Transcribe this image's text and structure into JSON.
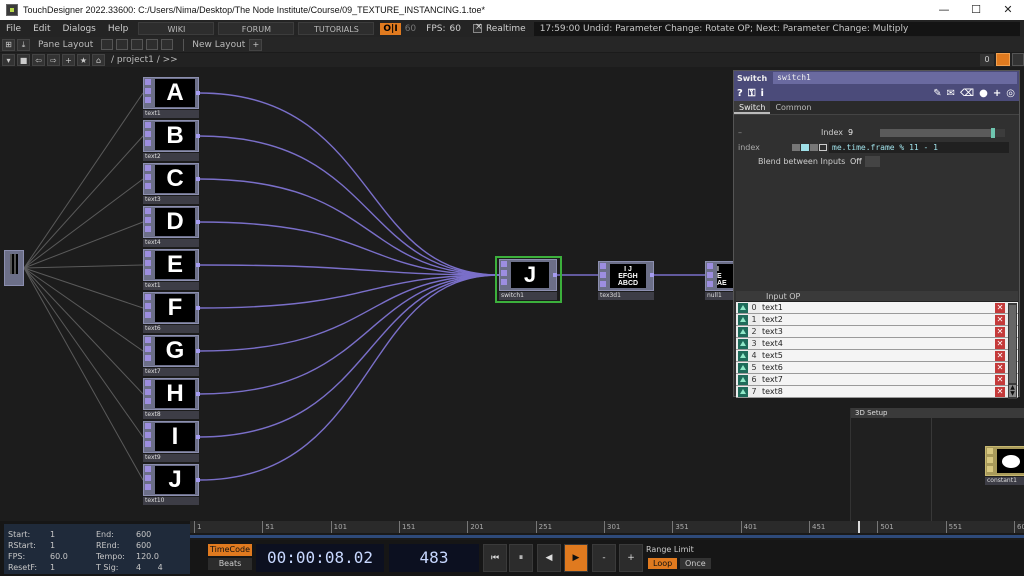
{
  "window": {
    "title": "TouchDesigner 2022.33600: C:/Users/Nima/Desktop/The Node Institute/Course/09_TEXTURE_INSTANCING.1.toe*",
    "minimize": "—",
    "maximize": "☐",
    "close": "✕"
  },
  "menubar": {
    "items": [
      "File",
      "Edit",
      "Dialogs",
      "Help"
    ],
    "wiki": "WIKI",
    "forum": "FORUM",
    "tutorials": "TUTORIALS",
    "oi": "O|I",
    "fps_target": "60",
    "fps_label": "FPS:",
    "fps_value": "60",
    "realtime": "Realtime",
    "status": "17:59:00 Undid: Parameter Change: Rotate OP; Next: Parameter Change: Multiply"
  },
  "panebar": {
    "pane_layout": "Pane Layout",
    "new_layout": "New Layout",
    "add": "+"
  },
  "pathbar": {
    "path": "/ project1 / >>",
    "page": "0"
  },
  "nodes": {
    "texts": [
      {
        "glyph": "A",
        "name": "text1"
      },
      {
        "glyph": "B",
        "name": "text2"
      },
      {
        "glyph": "C",
        "name": "text3"
      },
      {
        "glyph": "D",
        "name": "text4"
      },
      {
        "glyph": "E",
        "name": "text1"
      },
      {
        "glyph": "F",
        "name": "text6"
      },
      {
        "glyph": "G",
        "name": "text7"
      },
      {
        "glyph": "H",
        "name": "text8"
      },
      {
        "glyph": "I",
        "name": "text9"
      },
      {
        "glyph": "J",
        "name": "text10"
      }
    ],
    "switch": {
      "glyph": "J",
      "name": "switch1"
    },
    "tex3d": {
      "line1": "I J",
      "line2": "EFGH",
      "line3": "ABCD",
      "name": "tex3d1"
    },
    "null": {
      "line1": "I",
      "line2": "E",
      "line3": "AE",
      "name": "null1"
    },
    "constant": {
      "name": "constant1"
    }
  },
  "params": {
    "op_type": "Switch",
    "op_name": "switch1",
    "tabs": [
      "Switch",
      "Common"
    ],
    "index_label": "Index",
    "index_value": "9",
    "index_fraction": 0.9,
    "expr_label": "index",
    "expr_value": "me.time.frame % 11 - 1",
    "blend_label": "Blend between Inputs",
    "blend_value": "Off",
    "input_header": "Input OP",
    "inputs": [
      {
        "i": "0",
        "op": "text1"
      },
      {
        "i": "1",
        "op": "text2"
      },
      {
        "i": "2",
        "op": "text3"
      },
      {
        "i": "3",
        "op": "text4"
      },
      {
        "i": "4",
        "op": "text5"
      },
      {
        "i": "5",
        "op": "text6"
      },
      {
        "i": "6",
        "op": "text7"
      },
      {
        "i": "7",
        "op": "text8"
      }
    ]
  },
  "setup": {
    "title": "3D Setup"
  },
  "timeline": {
    "start_label": "Start:",
    "start": "1",
    "rstart_label": "RStart:",
    "rstart": "1",
    "fps_label": "FPS:",
    "fps": "60.0",
    "resetf_label": "ResetF:",
    "resetf": "1",
    "end_label": "End:",
    "end": "600",
    "rend_label": "REnd:",
    "rend": "600",
    "tempo_label": "Tempo:",
    "tempo": "120.0",
    "tsig_label": "T Sig:",
    "tsig_a": "4",
    "tsig_b": "4",
    "ticks": [
      "1",
      "51",
      "101",
      "151",
      "201",
      "251",
      "301",
      "351",
      "401",
      "451",
      "501",
      "551",
      "600"
    ],
    "timecode_btn": "TimeCode",
    "beats_btn": "Beats",
    "timecode": "00:00:08.02",
    "frame": "483",
    "range_limit": "Range Limit",
    "loop": "Loop",
    "once": "Once",
    "btn_start": "⏮",
    "btn_pause": "⏸",
    "btn_back": "◀",
    "btn_play": "▶",
    "btn_minus": "-",
    "btn_plus": "+"
  },
  "colors": {
    "wire": "#7a6fc9",
    "node_body": "#6c6f88",
    "selection": "#3cb03c",
    "accent": "#e07a1f",
    "param_header": "#4b4b7a"
  }
}
